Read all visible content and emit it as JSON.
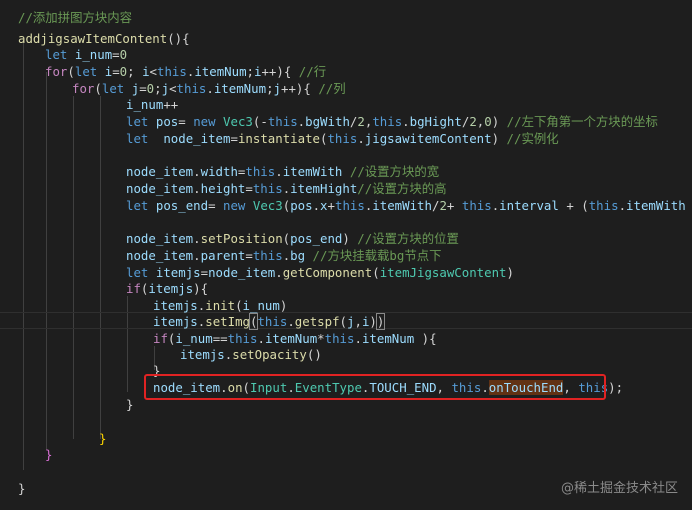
{
  "editor": {
    "comment_title": "//添加拼图方块内容",
    "fn_name": "addjigsawItemContent",
    "t_let": "let",
    "t_for": "for",
    "t_if": "if",
    "t_new": "new",
    "t_this": "this",
    "v_i_num": "i_num",
    "v_i": "i",
    "v_j": "j",
    "v_pos": "pos",
    "v_node_item": "node_item",
    "v_pos_end": "pos_end",
    "v_itemjs": "itemjs",
    "n_0": "0",
    "n_2": "2",
    "p_itemNum": "itemNum",
    "p_bgWith": "bgWith",
    "p_bgHight": "bgHight",
    "p_jigsawitemContent": "jigsawitemContent",
    "p_width": "width",
    "p_height": "height",
    "p_itemWith": "itemWith",
    "p_itemHight": "itemHight",
    "p_x": "x",
    "p_interval": "interval",
    "p_parent": "parent",
    "p_bg": "bg",
    "p_EventType": "EventType",
    "p_TOUCH_END": "TOUCH_END",
    "f_Vec3": "Vec3",
    "f_instantiate": "instantiate",
    "f_setPosition": "setPosition",
    "f_getComponent": "getComponent",
    "f_init": "init",
    "f_setImg": "setImg",
    "f_getspf": "getspf",
    "f_setOpacity": "setOpacity",
    "f_on": "on",
    "f_onTouchEnd": "onTouchEnd",
    "c_row": "//行",
    "c_col": "//列",
    "c_coord": "//左下角第一个方块的坐标",
    "c_instantiate": "//实例化",
    "c_width": "//设置方块的宽",
    "c_height": "//设置方块的高",
    "c_position": "//设置方块的位置",
    "c_mount": "//方块挂载载bg节点下",
    "t_itemJigsawContent": "itemJigsawContent",
    "t_Input": "Input",
    "s_eq": "=",
    "s_lt": "<",
    "s_semi": ";",
    "s_pp": "++",
    "s_lparen": "(",
    "s_rparen": ")",
    "s_lbrace": "{",
    "s_rbrace": "}",
    "s_dot": ".",
    "s_comma": ",",
    "s_slash": "/",
    "s_plus": "+",
    "s_minus": "-",
    "s_star": "*",
    "s_eqeq": "==",
    "s_space": " ",
    "s_brace_open": "){",
    "s_plus_sp": " + "
  },
  "watermark": "@稀土掘金技术社区",
  "colors": {
    "background": "#1e1e1e",
    "comment": "#6a9955",
    "function": "#dcdcaa",
    "keyword": "#569cd6",
    "control": "#c586c0",
    "variable": "#9cdcfe",
    "number": "#b5cea8",
    "type": "#4ec9b0",
    "highlight_box": "#e02323"
  }
}
